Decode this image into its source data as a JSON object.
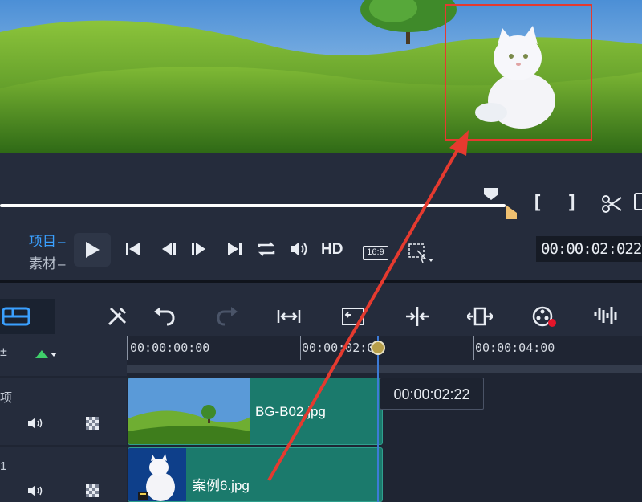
{
  "player": {
    "mode_project": "项目",
    "mode_clip": "素材",
    "hd_label": "HD",
    "aspect_label": "16:9",
    "timecode": "00:00:02:022",
    "mark_in": "[",
    "mark_out": "]"
  },
  "timeline": {
    "ruler_labels": [
      "00:00:00:00",
      "00:00:02:00",
      "00:00:04:00"
    ],
    "tooltip": "00:00:02:22",
    "tracks": [
      {
        "name": "项",
        "clip_label": "BG-B02.jpg"
      },
      {
        "name": "1",
        "clip_label": "案例6.jpg"
      }
    ]
  },
  "icons": {
    "play": "play-icon",
    "prev": "skip-start-icon",
    "step_back": "step-back-icon",
    "step_forward": "step-forward-icon",
    "next": "skip-end-icon",
    "repeat": "repeat-icon",
    "volume": "volume-icon",
    "scissor": "scissor-icon"
  },
  "colors": {
    "accent_blue": "#3aa0ff",
    "annotation_red": "#e53a2f",
    "clip_teal": "#1b7a6c",
    "playhead_blue": "#3d7bd6"
  }
}
